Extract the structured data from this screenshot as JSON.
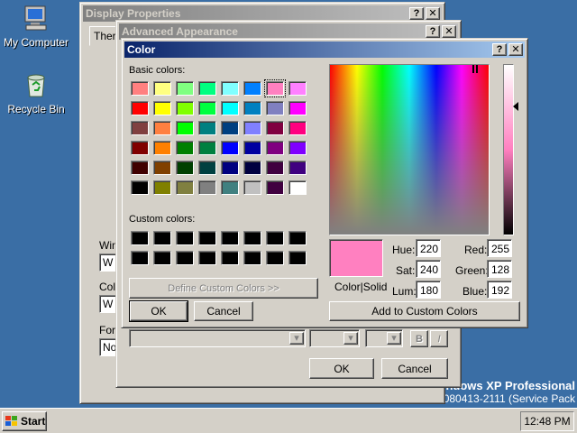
{
  "desktop": {
    "icons": [
      {
        "label": "My Computer",
        "icon": "my-computer-icon"
      },
      {
        "label": "Recycle Bin",
        "icon": "recycle-bin-icon"
      }
    ],
    "watermark": {
      "line1": "ndows XP Professional",
      "line2": "080413-2111 (Service Pack 3)"
    },
    "background": "#3a6ea5"
  },
  "display_properties": {
    "title": "Display Properties",
    "tab_fragment": "Ther",
    "label_fragments": [
      "Win",
      "Col",
      "For"
    ],
    "field_fragments": [
      "W",
      "W",
      "No"
    ],
    "help_label": "?",
    "close_label": "✕"
  },
  "advanced_appearance": {
    "title": "Advanced Appearance",
    "help_label": "?",
    "close_label": "✕",
    "bold_label": "B",
    "italic_label": "I",
    "ok_label": "OK",
    "cancel_label": "Cancel"
  },
  "color_dialog": {
    "title": "Color",
    "help_label": "?",
    "close_label": "✕",
    "basic_colors_label": "Basic colors:",
    "basic_colors": [
      [
        "#ff8080",
        "#ffff80",
        "#80ff80",
        "#00ff80",
        "#80ffff",
        "#0080ff",
        "#ff80c0",
        "#ff80ff"
      ],
      [
        "#ff0000",
        "#ffff00",
        "#80ff00",
        "#00ff40",
        "#00ffff",
        "#0080c0",
        "#8080c0",
        "#ff00ff"
      ],
      [
        "#804040",
        "#ff8040",
        "#00ff00",
        "#008080",
        "#004080",
        "#8080ff",
        "#800040",
        "#ff0080"
      ],
      [
        "#800000",
        "#ff8000",
        "#008000",
        "#008040",
        "#0000ff",
        "#0000a0",
        "#800080",
        "#8000ff"
      ],
      [
        "#400000",
        "#804000",
        "#004000",
        "#004040",
        "#000080",
        "#000040",
        "#400040",
        "#400080"
      ],
      [
        "#000000",
        "#808000",
        "#808040",
        "#808080",
        "#408080",
        "#c0c0c0",
        "#400040",
        "#ffffff"
      ]
    ],
    "selected_basic": {
      "row": 0,
      "col": 6
    },
    "custom_colors_label": "Custom colors:",
    "custom_colors": [
      [
        "#000000",
        "#000000",
        "#000000",
        "#000000",
        "#000000",
        "#000000",
        "#000000",
        "#000000"
      ],
      [
        "#000000",
        "#000000",
        "#000000",
        "#000000",
        "#000000",
        "#000000",
        "#000000",
        "#000000"
      ]
    ],
    "define_custom_label": "Define Custom Colors >>",
    "ok_label": "OK",
    "cancel_label": "Cancel",
    "preview_color": "#ff80c0",
    "color_solid_label": "Color|Solid",
    "hue_label": "Hue:",
    "hue": "220",
    "sat_label": "Sat:",
    "sat": "240",
    "lum_label": "Lum:",
    "lum": "180",
    "red_label": "Red:",
    "red": "255",
    "green_label": "Green:",
    "green": "128",
    "blue_label": "Blue:",
    "blue": "192",
    "add_custom_label": "Add to Custom Colors"
  },
  "taskbar": {
    "start_label": "Start",
    "clock": "12:48 PM"
  }
}
